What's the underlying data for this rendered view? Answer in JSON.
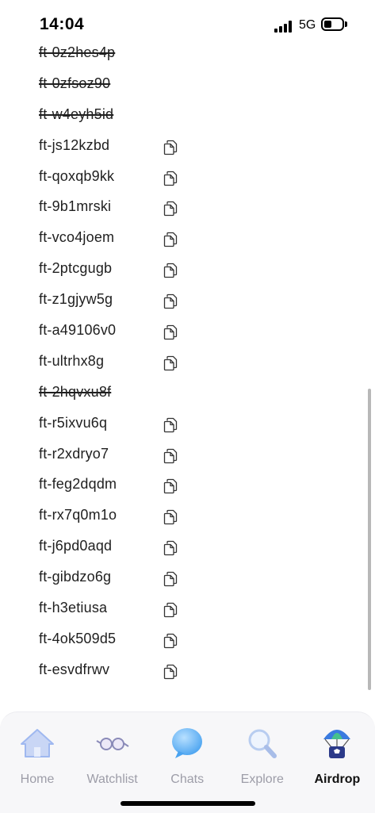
{
  "status_bar": {
    "time": "14:04",
    "network": "5G",
    "battery_level": 0.45
  },
  "codes": [
    {
      "code": "ft-0z2hes4p",
      "used": true
    },
    {
      "code": "ft-0zfsoz90",
      "used": true
    },
    {
      "code": "ft-w4eyh5id",
      "used": true
    },
    {
      "code": "ft-js12kzbd",
      "used": false
    },
    {
      "code": "ft-qoxqb9kk",
      "used": false
    },
    {
      "code": "ft-9b1mrski",
      "used": false
    },
    {
      "code": "ft-vco4joem",
      "used": false
    },
    {
      "code": "ft-2ptcgugb",
      "used": false
    },
    {
      "code": "ft-z1gjyw5g",
      "used": false
    },
    {
      "code": "ft-a49106v0",
      "used": false
    },
    {
      "code": "ft-ultrhx8g",
      "used": false
    },
    {
      "code": "ft-2hqvxu8f",
      "used": true
    },
    {
      "code": "ft-r5ixvu6q",
      "used": false
    },
    {
      "code": "ft-r2xdryo7",
      "used": false
    },
    {
      "code": "ft-feg2dqdm",
      "used": false
    },
    {
      "code": "ft-rx7q0m1o",
      "used": false
    },
    {
      "code": "ft-j6pd0aqd",
      "used": false
    },
    {
      "code": "ft-gibdzo6g",
      "used": false
    },
    {
      "code": "ft-h3etiusa",
      "used": false
    },
    {
      "code": "ft-4ok509d5",
      "used": false
    },
    {
      "code": "ft-esvdfrwv",
      "used": false
    }
  ],
  "tabs": [
    {
      "label": "Home",
      "icon": "home-icon",
      "active": false
    },
    {
      "label": "Watchlist",
      "icon": "glasses-icon",
      "active": false
    },
    {
      "label": "Chats",
      "icon": "chat-bubble-icon",
      "active": false
    },
    {
      "label": "Explore",
      "icon": "magnifier-icon",
      "active": false
    },
    {
      "label": "Airdrop",
      "icon": "parachute-icon",
      "active": true
    }
  ],
  "colors": {
    "tab_inactive": "#9d9da8",
    "tab_active": "#111111",
    "chat_blue": "#4aa3f0",
    "icon_blue": "#9fb8f0"
  }
}
